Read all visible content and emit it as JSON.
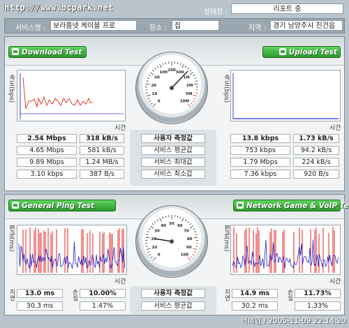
{
  "site": "http://www.bcpark.net",
  "status": {
    "label": "상태창 :",
    "value": "리포트 중"
  },
  "info": {
    "service_label": "서비스명 :",
    "service_value": "보라홈넷 케이블 프로",
    "place_label": "장소 :",
    "place_value": "집",
    "region_label": "지역 :",
    "region_value": "경기 남양주시 진건읍"
  },
  "download": {
    "title": "Download Test",
    "y_label": "속도(bps)",
    "x_label": "시간",
    "rows": [
      [
        "2.54 Mbps",
        "318 kB/s"
      ],
      [
        "4.65 Mbps",
        "581 kB/s"
      ],
      [
        "9.89 Mbps",
        "1.24 MB/s"
      ],
      [
        "3.10 kbps",
        "387 B/s"
      ]
    ]
  },
  "upload": {
    "title": "Upload Test",
    "y_label": "속도(bps)",
    "x_label": "시간",
    "rows": [
      [
        "13.8 kbps",
        "1.73 kB/s"
      ],
      [
        "753 kbps",
        "94.2 kB/s"
      ],
      [
        "1.79 Mbps",
        "224 kB/s"
      ],
      [
        "7.36 kbps",
        "920 B/s"
      ]
    ]
  },
  "middle_labels": [
    "사용자 측정값",
    "서비스 평균값",
    "서비스 최대값",
    "서비스 최소값"
  ],
  "ping": {
    "title": "General Ping Test",
    "y_label": "편균(ms)",
    "x_label": "시간",
    "delay_label": "지연",
    "loss_label": "손실",
    "delay_rows": [
      "13.0 ms",
      "30.3 ms"
    ],
    "loss_rows": [
      "10.00%",
      "1.47%"
    ]
  },
  "game": {
    "title": "Network Game & VoIP Test",
    "y_label": "편균(ms)",
    "x_label": "시간",
    "delay_label": "지연",
    "loss_label": "손실",
    "delay_rows": [
      "14.9 ms",
      "30.2 ms"
    ],
    "loss_rows": [
      "11.73%",
      "1.33%"
    ]
  },
  "ping_middle_labels": [
    "사용자 측정값",
    "서비스 평균값"
  ],
  "gauge_top": {
    "ticks": [
      "0",
      "10",
      "20",
      "50",
      "100",
      "200",
      "500",
      "1M",
      "2M",
      "5M",
      "10M"
    ]
  },
  "gauge_bottom": {
    "ticks": [
      "0",
      "10",
      "20",
      "30",
      "40",
      "50",
      "60",
      "70",
      "80",
      "90",
      "100"
    ]
  },
  "footer": "닉네임 / 2005-11-09 22:14:20",
  "colors": {
    "accent_green": "#36aa36",
    "download_line": "#e03a2a",
    "upload_line": "#2a2ad8",
    "ping_red": "#e02020",
    "ping_blue": "#2020c8"
  }
}
